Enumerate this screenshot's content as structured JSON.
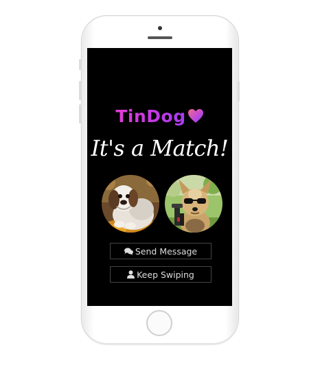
{
  "brand": {
    "name": "TinDog",
    "heart_icon": "heart-icon",
    "gradient": [
      "#e33cd6",
      "#a63cf0"
    ]
  },
  "match": {
    "title": "It's a Match!"
  },
  "profiles": [
    {
      "icon": "shih-tzu-photo"
    },
    {
      "icon": "yorkie-sunglasses-photo"
    }
  ],
  "actions": {
    "send_message": {
      "label": "Send Message",
      "icon": "chat-bubbles-icon"
    },
    "keep_swiping": {
      "label": "Keep Swiping",
      "icon": "user-icon"
    }
  },
  "colors": {
    "screen_bg": "#000000",
    "button_border": "#444444",
    "button_text": "#dddddd"
  }
}
